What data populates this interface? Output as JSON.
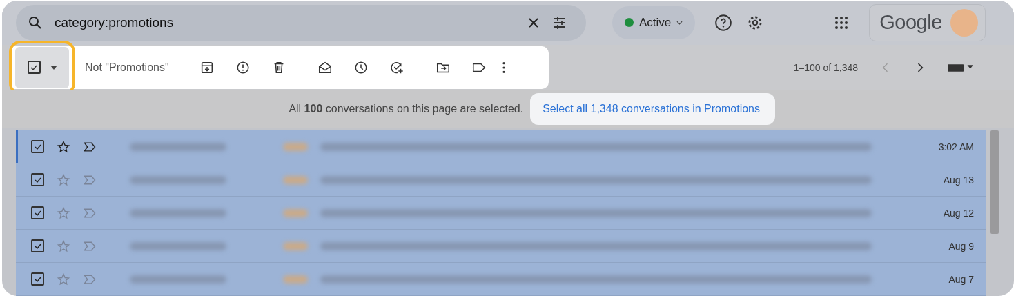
{
  "search": {
    "value": "category:promotions"
  },
  "status": {
    "label": "Active",
    "color": "#1e8e3e"
  },
  "brand": "Google",
  "toolbar": {
    "select_checked": true,
    "highlighted": true,
    "label": "Not \"Promotions\"",
    "pagination": "1–100 of 1,348"
  },
  "banner": {
    "text": "All **100** conversations on this page are selected.",
    "link": "Select all 1,348 conversations in Promotions"
  },
  "rows": [
    {
      "checked": true,
      "focused": true,
      "time": "3:02 AM"
    },
    {
      "checked": true,
      "focused": false,
      "time": "Aug 13"
    },
    {
      "checked": true,
      "focused": false,
      "time": "Aug 12"
    },
    {
      "checked": true,
      "focused": false,
      "time": "Aug 9"
    },
    {
      "checked": true,
      "focused": false,
      "time": "Aug 7"
    }
  ]
}
